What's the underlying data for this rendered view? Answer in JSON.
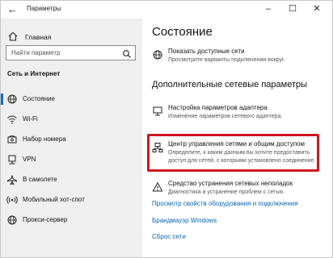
{
  "window": {
    "title": "Параметры",
    "controls": {
      "minimize": "–",
      "maximize": "☐",
      "close": "✕"
    }
  },
  "sidebar": {
    "home_label": "Главная",
    "search_placeholder": "Найти параметр",
    "section_title": "Сеть и Интернет",
    "items": [
      {
        "label": "Состояние",
        "icon": "globe-icon",
        "active": true
      },
      {
        "label": "Wi-Fi",
        "icon": "wifi-icon"
      },
      {
        "label": "Набор номера",
        "icon": "phone-icon"
      },
      {
        "label": "VPN",
        "icon": "vpn-icon"
      },
      {
        "label": "В самолете",
        "icon": "airplane-icon"
      },
      {
        "label": "Мобильный хот-спот",
        "icon": "hotspot-icon"
      },
      {
        "label": "Прокси-сервер",
        "icon": "globe-icon"
      }
    ]
  },
  "main": {
    "heading": "Состояние",
    "show_networks": {
      "title": "Показать доступные сети",
      "desc": "Просмотрите варианты подключения вокруг."
    },
    "advanced_heading": "Дополнительные сетевые параметры",
    "adapter": {
      "title": "Настройка параметров адаптера",
      "desc": "Изменение параметров сетевого адаптера."
    },
    "sharing_center": {
      "title": "Центр управления сетями и общим доступом",
      "desc_line1": "Определите, к каким данным вы хотите предоставить",
      "desc_line2": "доступ для сетей, с которыми установлено соединение."
    },
    "troubleshoot": {
      "title": "Средство устранения сетевых неполадок",
      "desc": "Диагностика и устранение проблем с сетью."
    },
    "links": [
      "Просмотр свойств оборудования и подключения",
      "Брандмауэр Windows",
      "Сброс сети"
    ]
  },
  "colors": {
    "accent": "#0a63b5",
    "highlight": "#d0141f",
    "sidebar_bg": "#efefef"
  }
}
